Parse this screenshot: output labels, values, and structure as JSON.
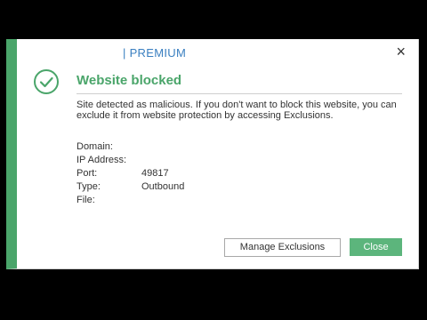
{
  "header": {
    "brand_text": "| PREMIUM",
    "close_glyph": "×"
  },
  "status": {
    "icon": "check-circle-icon",
    "title": "Website blocked",
    "description": "Site detected as malicious. If you don't want to block this website, you can exclude it from website protection by accessing Exclusions."
  },
  "details": [
    {
      "label": "Domain:",
      "value": ""
    },
    {
      "label": "IP Address:",
      "value": ""
    },
    {
      "label": "Port:",
      "value": "49817"
    },
    {
      "label": "Type:",
      "value": "Outbound"
    },
    {
      "label": "File:",
      "value": ""
    }
  ],
  "buttons": {
    "manage_exclusions": "Manage Exclusions",
    "close": "Close"
  },
  "colors": {
    "accent_green": "#4aa56a",
    "button_green": "#5cb57c",
    "brand_blue": "#3a7fc0"
  }
}
